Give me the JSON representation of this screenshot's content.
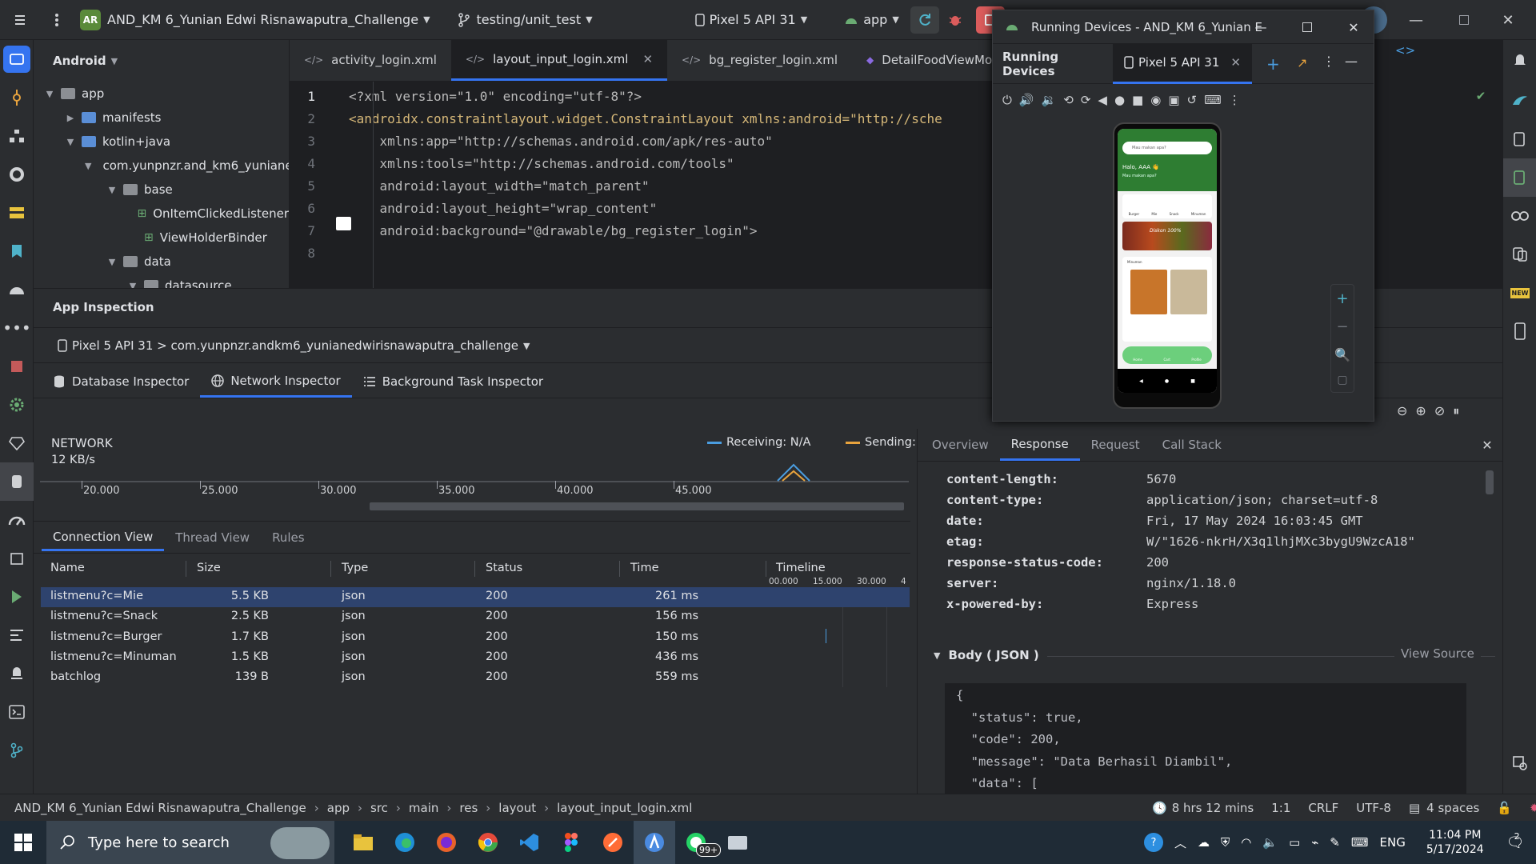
{
  "titlebar": {
    "project_initials": "AR",
    "project_name": "AND_KM 6_Yunian Edwi Risnawaputra_Challenge",
    "branch": "testing/unit_test",
    "device": "Pixel 5 API 31",
    "run_config": "app"
  },
  "project_panel": {
    "view": "Android",
    "items": [
      {
        "label": "app",
        "depth": 0,
        "open": true,
        "icon": "module-folder-icon"
      },
      {
        "label": "manifests",
        "depth": 1,
        "open": false,
        "icon": "folder-icon"
      },
      {
        "label": "kotlin+java",
        "depth": 1,
        "open": true,
        "icon": "folder-icon"
      },
      {
        "label": "com.yunpnzr.and_km6_yuniane",
        "depth": 2,
        "open": true,
        "icon": "package-icon"
      },
      {
        "label": "base",
        "depth": 3,
        "open": true,
        "icon": "package-icon"
      },
      {
        "label": "OnItemClickedListener",
        "depth": 4,
        "open": null,
        "icon": "interface-icon"
      },
      {
        "label": "ViewHolderBinder",
        "depth": 4,
        "open": null,
        "icon": "interface-icon"
      },
      {
        "label": "data",
        "depth": 3,
        "open": true,
        "icon": "package-icon"
      },
      {
        "label": "datasource",
        "depth": 4,
        "open": true,
        "icon": "package-icon"
      }
    ]
  },
  "editor": {
    "tabs": [
      {
        "label": "activity_login.xml",
        "active": false
      },
      {
        "label": "layout_input_login.xml",
        "active": true
      },
      {
        "label": "bg_register_login.xml",
        "active": false
      },
      {
        "label": "DetailFoodViewModel.kt",
        "active": false
      }
    ],
    "lines": [
      {
        "n": "1",
        "code": "<?xml version=\"1.0\" encoding=\"utf-8\"?>"
      },
      {
        "n": "2",
        "code": "<androidx.constraintlayout.widget.ConstraintLayout xmlns:android=\"http://sche"
      },
      {
        "n": "3",
        "code": "    xmlns:app=\"http://schemas.android.com/apk/res-auto\""
      },
      {
        "n": "4",
        "code": "    xmlns:tools=\"http://schemas.android.com/tools\""
      },
      {
        "n": "5",
        "code": "    android:layout_width=\"match_parent\""
      },
      {
        "n": "6",
        "code": "    android:layout_height=\"wrap_content\""
      },
      {
        "n": "7",
        "code": "    android:background=\"@drawable/bg_register_login\">"
      },
      {
        "n": "8",
        "code": ""
      }
    ]
  },
  "inspection": {
    "title": "App Inspection",
    "process": "Pixel 5 API 31 > com.yunpnzr.andkm6_yunianedwirisnawaputra_challenge",
    "tabs": [
      "Database Inspector",
      "Network Inspector",
      "Background Task Inspector"
    ],
    "active_tab": 1,
    "network": {
      "title": "NETWORK",
      "rate": "12 KB/s",
      "legend_receiving": "Receiving: N/A",
      "legend_sending": "Sending: N/A",
      "axis_ticks": [
        "20.000",
        "25.000",
        "30.000",
        "35.000",
        "40.000",
        "45.000"
      ]
    },
    "view_tabs": [
      "Connection View",
      "Thread View",
      "Rules"
    ],
    "columns": [
      "Name",
      "Size",
      "Type",
      "Status",
      "Time",
      "Timeline"
    ],
    "timeline_ticks": [
      "00.000",
      "15.000",
      "30.000",
      "4"
    ],
    "rows": [
      {
        "name": "listmenu?c=Mie",
        "size": "5.5 KB",
        "type": "json",
        "status": "200",
        "time": "261 ms",
        "selected": true
      },
      {
        "name": "listmenu?c=Snack",
        "size": "2.5 KB",
        "type": "json",
        "status": "200",
        "time": "156 ms",
        "selected": false
      },
      {
        "name": "listmenu?c=Burger",
        "size": "1.7 KB",
        "type": "json",
        "status": "200",
        "time": "150 ms",
        "selected": false
      },
      {
        "name": "listmenu?c=Minuman",
        "size": "1.5 KB",
        "type": "json",
        "status": "200",
        "time": "436 ms",
        "selected": false
      },
      {
        "name": "batchlog",
        "size": "139 B",
        "type": "json",
        "status": "200",
        "time": "559 ms",
        "selected": false
      }
    ]
  },
  "response": {
    "tabs": [
      "Overview",
      "Response",
      "Request",
      "Call Stack"
    ],
    "active_tab": 1,
    "headers": [
      {
        "k": "content-length:",
        "v": "5670"
      },
      {
        "k": "content-type:",
        "v": "application/json; charset=utf-8"
      },
      {
        "k": "date:",
        "v": "Fri, 17 May 2024 16:03:45 GMT"
      },
      {
        "k": "etag:",
        "v": "W/\"1626-nkrH/X3q1lhjMXc3bygU9WzcA18\""
      },
      {
        "k": "response-status-code:",
        "v": "200"
      },
      {
        "k": "server:",
        "v": "nginx/1.18.0"
      },
      {
        "k": "x-powered-by:",
        "v": "Express"
      }
    ],
    "body_title": "Body ( JSON )",
    "view_source": "View Source",
    "body_lines": [
      "{",
      "  \"status\": true,",
      "  \"code\": 200,",
      "  \"message\": \"Data Berhasil Diambil\",",
      "  \"data\": ["
    ]
  },
  "running_devices": {
    "window_title": "Running Devices - AND_KM 6_Yunian E",
    "panel_title": "Running Devices",
    "device_tab": "Pixel 5 API 31",
    "phone": {
      "search_placeholder": "Mau makan apa?",
      "greeting": "Halo, AAA 👋",
      "subtitle": "Mau makan apa?",
      "categories": [
        "Burger",
        "Mie",
        "Snack",
        "Minuman"
      ],
      "banner": "Diskon 100%",
      "section": "Minuman",
      "nav": [
        "Home",
        "Cart",
        "Profile"
      ]
    }
  },
  "statusbar": {
    "breadcrumb": [
      "AND_KM 6_Yunian Edwi Risnawaputra_Challenge",
      "app",
      "src",
      "main",
      "res",
      "layout",
      "layout_input_login.xml"
    ],
    "time_spent": "8 hrs 12 mins",
    "position": "1:1",
    "line_sep": "CRLF",
    "encoding": "UTF-8",
    "indent": "4 spaces"
  },
  "taskbar": {
    "search_placeholder": "Type here to search",
    "whatsapp_badge": "99+",
    "lang": "ENG",
    "time": "11:04 PM",
    "date": "5/17/2024",
    "notif_count": "2"
  },
  "colors": {
    "accent": "#3574f0",
    "selected_row": "#2e436e",
    "phone_green": "#2e7d32"
  }
}
